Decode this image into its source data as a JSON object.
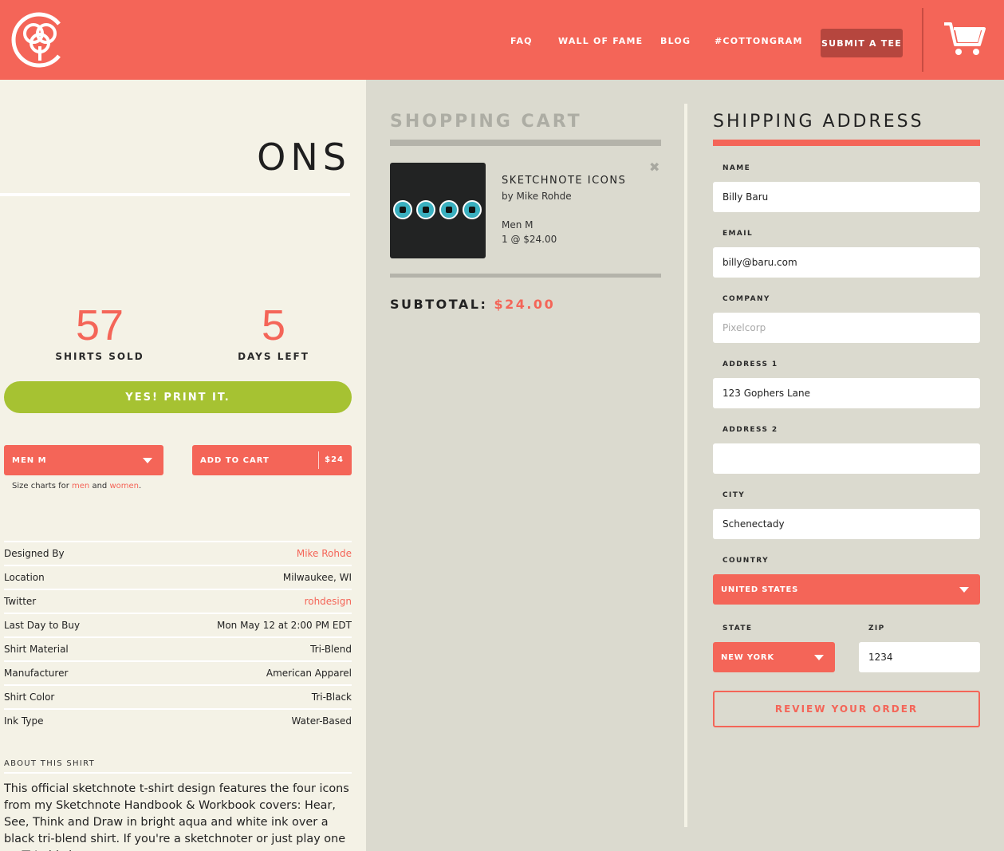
{
  "header": {
    "nav": [
      {
        "label": "FAQ"
      },
      {
        "label": "WALL OF FAME"
      },
      {
        "label": "BLOG"
      },
      {
        "label": "#COTTONGRAM"
      }
    ],
    "submit_label": "SUBMIT A TEE",
    "logo_icon": "cotton-bureau-logo-icon",
    "cart_icon": "shopping-cart-icon"
  },
  "product": {
    "title_fragment": "ONS",
    "stats": {
      "sold_number": "57",
      "sold_label": "SHIRTS SOLD",
      "days_number": "5",
      "days_label": "DAYS LEFT"
    },
    "cta_label": "YES! PRINT IT.",
    "size_selected": "MEN M",
    "add_to_cart_label": "ADD TO CART",
    "add_to_cart_price": "$24",
    "size_note": {
      "prefix": "Size charts for ",
      "men": "men",
      "and": " and ",
      "women": "women",
      "suffix": "."
    },
    "details": [
      {
        "label": "Designed By",
        "value": "Mike Rohde",
        "link": true
      },
      {
        "label": "Location",
        "value": "Milwaukee, WI",
        "link": false
      },
      {
        "label": "Twitter",
        "value": "rohdesign",
        "link": true
      },
      {
        "label": "Last Day to Buy",
        "value": "Mon May 12 at 2:00 PM EDT",
        "link": false
      },
      {
        "label": "Shirt Material",
        "value": "Tri-Blend",
        "link": false
      },
      {
        "label": "Manufacturer",
        "value": "American Apparel",
        "link": false
      },
      {
        "label": "Shirt Color",
        "value": "Tri-Black",
        "link": false
      },
      {
        "label": "Ink Type",
        "value": "Water-Based",
        "link": false
      }
    ],
    "about_heading": "ABOUT THIS SHIRT",
    "about_text": "This official sketchnote t-shirt design features the four icons from my Sketchnote Handbook & Workbook covers: Hear, See, Think and Draw in bright aqua and white ink over a black tri-blend shirt. If you're a sketchnoter or just play one on TV, this is"
  },
  "cart": {
    "title": "SHOPPING CART",
    "item": {
      "name": "SKETCHNOTE ICONS",
      "by": "by Mike Rohde",
      "size": "Men M",
      "qty_price": "1 @ $24.00"
    },
    "close_icon": "close-icon",
    "subtotal_label": "SUBTOTAL:",
    "subtotal_value": "$24.00"
  },
  "shipping": {
    "title": "SHIPPING ADDRESS",
    "name_label": "NAME",
    "name_value": "Billy Baru",
    "email_label": "EMAIL",
    "email_value": "billy@baru.com",
    "company_label": "COMPANY",
    "company_placeholder": "Pixelcorp",
    "address1_label": "ADDRESS 1",
    "address1_value": "123 Gophers Lane",
    "address2_label": "ADDRESS 2",
    "address2_value": "",
    "city_label": "CITY",
    "city_value": "Schenectady",
    "country_label": "COUNTRY",
    "country_value": "UNITED STATES",
    "state_label": "STATE",
    "state_value": "NEW YORK",
    "zip_label": "ZIP",
    "zip_value": "1234",
    "review_label": "REVIEW YOUR ORDER"
  },
  "colors": {
    "accent": "#f46558",
    "cta_green": "#a6c232",
    "panel_bg": "#dbdacf",
    "page_bg": "#f4f2e6"
  }
}
